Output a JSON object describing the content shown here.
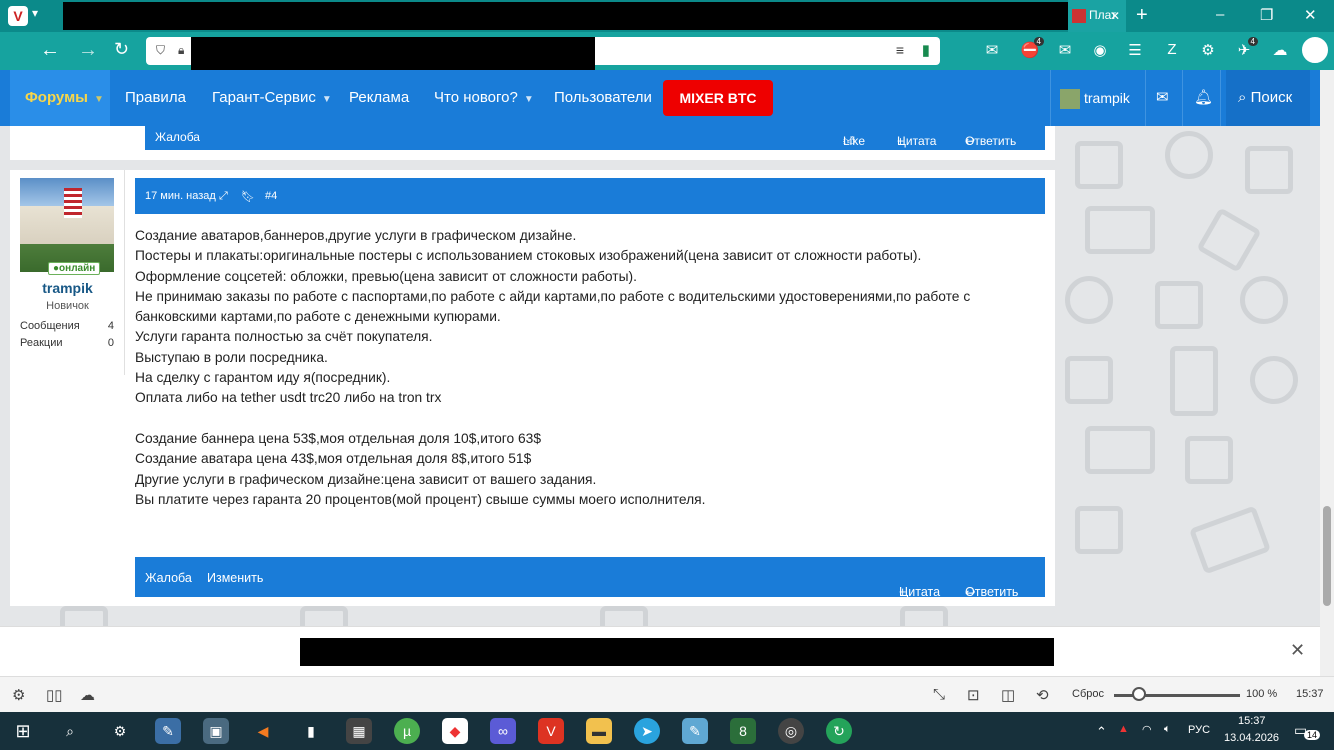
{
  "browser": {
    "tab_title": "Плат",
    "new_tab": "+",
    "window_controls": [
      "–",
      "❐",
      "✕"
    ],
    "ext_badge_1": "4",
    "ext_badge_2": "4"
  },
  "nav": {
    "forums": "Форумы",
    "rules": "Правила",
    "garant": "Гарант-Сервис",
    "ads": "Реклама",
    "whats_new": "Что нового?",
    "users": "Пользователи",
    "mixer": "MIXER BTC",
    "username": "trampik",
    "search": "Поиск"
  },
  "prev_post": {
    "complaint": "Жалоба",
    "like": "Like",
    "quote": "Цитата",
    "reply": "Ответить"
  },
  "post": {
    "time": "17 мин. назад",
    "number": "#4",
    "user": {
      "name": "trampik",
      "status": "онлайн",
      "rank": "Новичок",
      "messages_label": "Сообщения",
      "messages": "4",
      "reactions_label": "Реакции",
      "reactions": "0"
    },
    "lines": [
      "Создание аватаров,баннеров,другие услуги в графическом дизайне.",
      "Постеры и плакаты:оригинальные постеры с использованием стоковых изображений(цена зависит от сложности работы).",
      "Оформление соцсетей: обложки, превью(цена зависит от сложности работы).",
      "Не принимаю заказы по работе с паспортами,по работе с айди картами,по работе с водительскими удостоверениями,по работе с",
      "банковскими картами,по работе с денежными купюрами.",
      "Услуги гаранта полностью за счёт покупателя.",
      "Выступаю в роли посредника.",
      "На сделку с гарантом иду я(посредник).",
      "Оплата либо на tether usdt trc20 либо на tron trx",
      "",
      "Создание баннера цена 53$,моя отдельная доля 10$,итого 63$",
      "Создание аватара цена 43$,моя отдельная доля 8$,итого 51$",
      "Другие услуги в графическом дизайне:цена зависит от вашего задания.",
      "Вы платите через гаранта 20 процентов(мой процент) свыше суммы моего исполнителя."
    ],
    "footer": {
      "complaint": "Жалоба",
      "edit": "Изменить",
      "quote": "Цитата",
      "reply": "Ответить"
    }
  },
  "statusbar": {
    "reset": "Сброс",
    "zoom": "100 %",
    "time": "15:37"
  },
  "taskbar": {
    "lang": "РУС",
    "time": "15:37",
    "date": "13.04.2026",
    "notif_count": "14"
  },
  "colors": {
    "accent": "#1a7cd8",
    "mixer": "#e00000",
    "forums_active": "#f7d64a"
  }
}
